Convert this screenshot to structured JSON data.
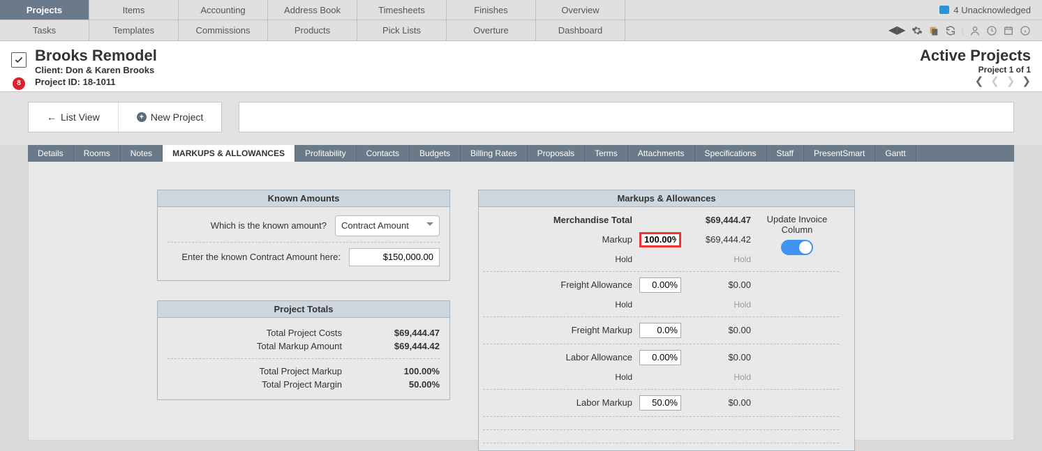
{
  "topnav": {
    "row1": [
      "Projects",
      "Items",
      "Accounting",
      "Address Book",
      "Timesheets",
      "Finishes",
      "Overview"
    ],
    "row2": [
      "Tasks",
      "Templates",
      "Commissions",
      "Products",
      "Pick Lists",
      "Overture",
      "Dashboard"
    ],
    "active_index": 0,
    "unacknowledged_label": "4 Unacknowledged"
  },
  "project": {
    "title": "Brooks Remodel",
    "client_label": "Client: Don & Karen Brooks",
    "id_label": "Project ID: 18-1011",
    "badge": "8",
    "active_label": "Active Projects",
    "counter": "Project 1 of 1"
  },
  "actions": {
    "list_view": "List View",
    "new_project": "New Project"
  },
  "subtabs": [
    "Details",
    "Rooms",
    "Notes",
    "MARKUPS & ALLOWANCES",
    "Profitability",
    "Contacts",
    "Budgets",
    "Billing Rates",
    "Proposals",
    "Terms",
    "Attachments",
    "Specifications",
    "Staff",
    "PresentSmart",
    "Gantt"
  ],
  "subtab_active": 3,
  "known": {
    "panel_title": "Known Amounts",
    "q1": "Which is the known amount?",
    "q1_value": "Contract Amount",
    "q2": "Enter the known Contract Amount here:",
    "q2_value": "$150,000.00"
  },
  "totals": {
    "panel_title": "Project Totals",
    "rows": [
      {
        "label": "Total Project Costs",
        "value": "$69,444.47"
      },
      {
        "label": "Total Markup Amount",
        "value": "$69,444.42"
      }
    ],
    "rows2": [
      {
        "label": "Total Project Markup",
        "value": "100.00%"
      },
      {
        "label": "Total Project Margin",
        "value": "50.00%"
      }
    ]
  },
  "ma": {
    "panel_title": "Markups & Allowances",
    "merch_label": "Merchandise  Total",
    "merch_value": "$69,444.47",
    "markup_label": "Markup",
    "markup_pct": "100.00%",
    "markup_value": "$69,444.42",
    "hold_label": "Hold",
    "hold_value": "Hold",
    "freight_allow_label": "Freight Allowance",
    "freight_allow_pct": "0.00%",
    "freight_allow_value": "$0.00",
    "freight_markup_label": "Freight Markup",
    "freight_markup_pct": "0.0%",
    "freight_markup_value": "$0.00",
    "labor_allow_label": "Labor Allowance",
    "labor_allow_pct": "0.00%",
    "labor_allow_value": "$0.00",
    "labor_markup_label": "Labor Markup",
    "labor_markup_pct": "50.0%",
    "labor_markup_value": "$0.00",
    "update_invoice": "Update Invoice Column"
  }
}
